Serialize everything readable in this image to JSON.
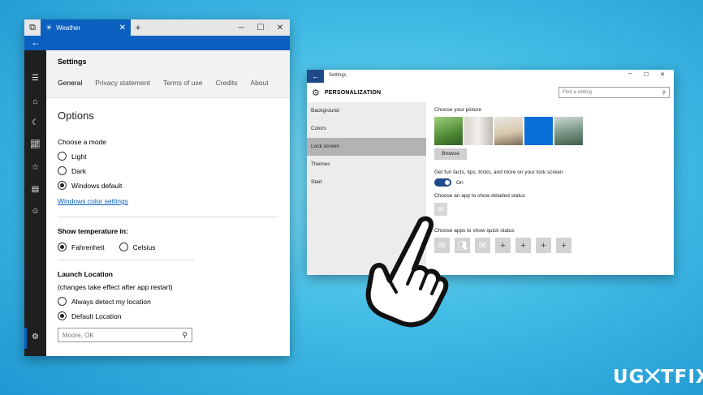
{
  "weather": {
    "tab_title": "Weather",
    "header_title": "Settings",
    "tabs": [
      "General",
      "Privacy statement",
      "Terms of use",
      "Credits",
      "About"
    ],
    "options_heading": "Options",
    "mode_label": "Choose a mode",
    "modes": [
      "Light",
      "Dark",
      "Windows default"
    ],
    "selected_mode": "Windows default",
    "color_link": "Windows color settings",
    "temp_label": "Show temperature in:",
    "temp_units": [
      "Fahrenheit",
      "Celsius"
    ],
    "selected_temp": "Fahrenheit",
    "launch_label": "Launch Location",
    "launch_note": "(changes take effect after app restart)",
    "launch_options": [
      "Always detect my location",
      "Default Location"
    ],
    "selected_launch": "Default Location",
    "location_value": "Moore, OK"
  },
  "settings": {
    "window_title": "Settings",
    "page_title": "PERSONALIZATION",
    "search_placeholder": "Find a setting",
    "nav": [
      "Background",
      "Colors",
      "Lock screen",
      "Themes",
      "Start"
    ],
    "active_nav": "Lock screen",
    "choose_picture": "Choose your picture",
    "browse": "Browse",
    "fun_facts": "Get fun facts, tips, tricks, and more on your lock screen",
    "toggle_state": "On",
    "detailed_status": "Choose an app to show detailed status",
    "quick_status": "Choose apps to show quick status"
  },
  "watermark": "UG⨉TFIX",
  "colors": {
    "accent": "#0a5fbf",
    "settings_accent": "#1f4a8a",
    "background": "#44bde6"
  }
}
